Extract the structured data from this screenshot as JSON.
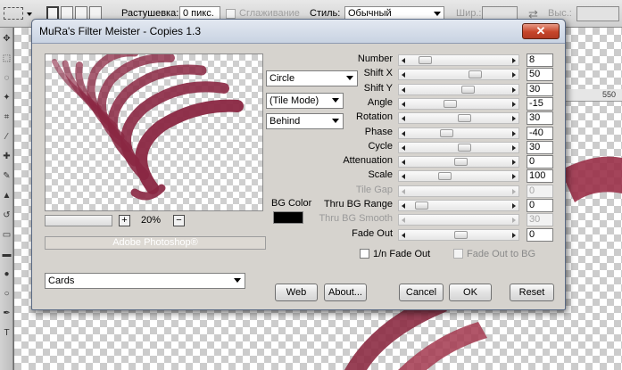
{
  "options_bar": {
    "feather_label": "Растушевка:",
    "feather_value": "0 пикс.",
    "antialias_label": "Сглаживание",
    "style_label": "Стиль:",
    "style_value": "Обычный",
    "width_label": "Шир.:",
    "height_label": "Выс.:",
    "swap_symbol": "⇄"
  },
  "ruler": {
    "tick_label": "550"
  },
  "dialog": {
    "title": "MuRa's Filter Meister - Copies 1.3",
    "close_symbol": "✕",
    "zoom_minus": "−",
    "zoom_plus": "+",
    "zoom_value": "20%",
    "host_label": "Adobe Photoshop®",
    "dropdowns": {
      "shape": "Circle",
      "tile_mode": "(Tile Mode)",
      "layer_mode": "Behind",
      "preset": "Cards"
    },
    "bg_color_label": "BG Color",
    "bg_color": "#000000",
    "params": [
      {
        "label": "Number",
        "value": "8",
        "enabled": true,
        "pos": 0.12
      },
      {
        "label": "Shift X",
        "value": "50",
        "enabled": true,
        "pos": 0.68
      },
      {
        "label": "Shift Y",
        "value": "30",
        "enabled": true,
        "pos": 0.6
      },
      {
        "label": "Angle",
        "value": "-15",
        "enabled": true,
        "pos": 0.4
      },
      {
        "label": "Rotation",
        "value": "30",
        "enabled": true,
        "pos": 0.56
      },
      {
        "label": "Phase",
        "value": "-40",
        "enabled": true,
        "pos": 0.36
      },
      {
        "label": "Cycle",
        "value": "30",
        "enabled": true,
        "pos": 0.56
      },
      {
        "label": "Attenuation",
        "value": "0",
        "enabled": true,
        "pos": 0.52
      },
      {
        "label": "Scale",
        "value": "100",
        "enabled": true,
        "pos": 0.34
      },
      {
        "label": "Tile Gap",
        "value": "0",
        "enabled": false,
        "pos": null
      },
      {
        "label": "Thru BG Range",
        "value": "0",
        "enabled": true,
        "pos": 0.08
      },
      {
        "label": "Thru BG Smooth",
        "value": "30",
        "enabled": false,
        "pos": null
      },
      {
        "label": "Fade Out",
        "value": "0",
        "enabled": true,
        "pos": 0.52
      }
    ],
    "checkboxes": {
      "one_n_fade_out": "1/n Fade Out",
      "fade_out_to_bg": "Fade Out to BG"
    },
    "buttons": {
      "web": "Web",
      "about": "About...",
      "cancel": "Cancel",
      "ok": "OK",
      "reset": "Reset"
    }
  }
}
